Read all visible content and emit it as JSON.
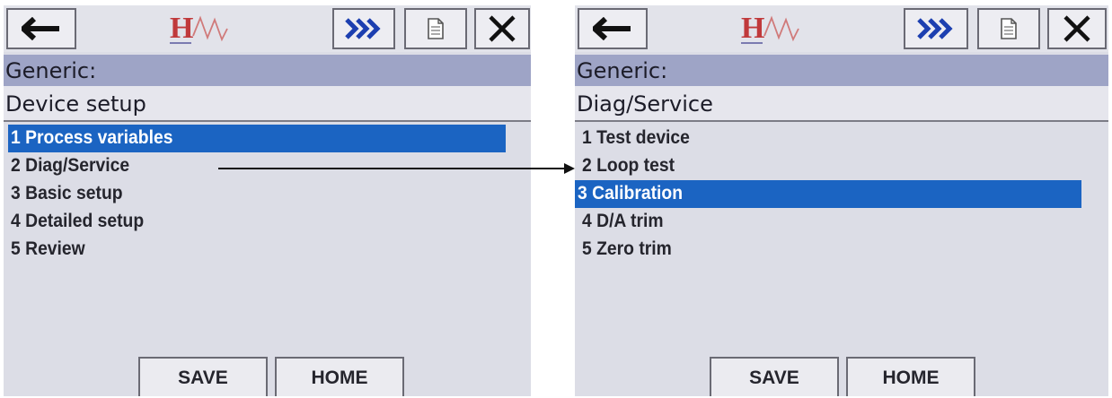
{
  "screens": [
    {
      "header_line1": "Generic:",
      "header_line2": "Device setup",
      "menu_items": [
        "1 Process variables",
        "2 Diag/Service",
        "3 Basic setup",
        "4 Detailed setup",
        "5 Review"
      ],
      "selected_index": 0,
      "buttons": {
        "save": "SAVE",
        "home": "HOME"
      }
    },
    {
      "header_line1": "Generic:",
      "header_line2": "Diag/Service",
      "menu_items": [
        "1 Test device",
        "2 Loop test",
        "3 Calibration",
        "4 D/A trim",
        "5 Zero trim"
      ],
      "selected_index": 2,
      "buttons": {
        "save": "SAVE",
        "home": "HOME"
      }
    }
  ],
  "logo_text": "H",
  "colors": {
    "selection": "#1b64c2",
    "header_band": "#9ea4c6",
    "logo_red": "#c0393b"
  }
}
